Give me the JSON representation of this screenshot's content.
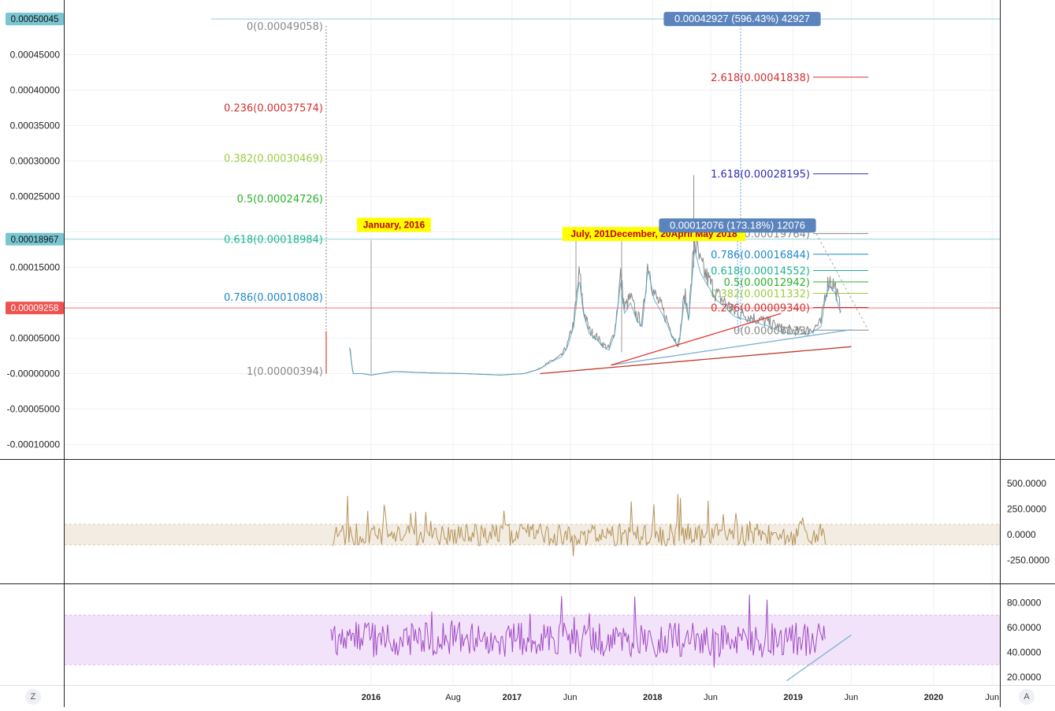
{
  "chart_data": [
    {
      "type": "line",
      "pane": "price",
      "y_ticks": [
        "0.00045000",
        "0.00040000",
        "0.00035000",
        "0.00030000",
        "0.00025000",
        "0.00015000",
        "0.00005000",
        "-0.00000000",
        "-0.00005000",
        "-0.00010000"
      ],
      "y_tick_values": [
        0.00045,
        0.0004,
        0.00035,
        0.0003,
        0.00025,
        0.00015,
        5e-05,
        0,
        -5e-05,
        -0.0001
      ],
      "ylim": [
        -0.000125,
        0.0005
      ],
      "price_labels": [
        {
          "text": "0.00050045",
          "value": 0.00050045,
          "color": "#79c6d2"
        },
        {
          "text": "0.00018967",
          "value": 0.00018967,
          "color": "#79c6d2"
        },
        {
          "text": "0.00009258",
          "value": 9.258e-05,
          "color": "#ef5350"
        }
      ],
      "x_ticks": [
        {
          "label": "2016",
          "date": "2016-01-01",
          "bold": true
        },
        {
          "label": "Aug",
          "date": "2016-08-01",
          "bold": false
        },
        {
          "label": "2017",
          "date": "2017-01-01",
          "bold": true
        },
        {
          "label": "Jun",
          "date": "2017-06-01",
          "bold": false
        },
        {
          "label": "2018",
          "date": "2018-01-01",
          "bold": true
        },
        {
          "label": "Jun",
          "date": "2018-06-01",
          "bold": false
        },
        {
          "label": "2019",
          "date": "2019-01-01",
          "bold": true
        },
        {
          "label": "Jun",
          "date": "2019-06-01",
          "bold": false
        },
        {
          "label": "2020",
          "date": "2020-01-01",
          "bold": true
        },
        {
          "label": "Jun",
          "date": "2020-06-01",
          "bold": false
        }
      ],
      "price_series": [
        [
          "2015-11-06",
          3.9e-05
        ],
        [
          "2015-11-15",
          0.0
        ],
        [
          "2015-12-10",
          0.0
        ],
        [
          "2016-01-01",
          -2e-06
        ],
        [
          "2016-03-01",
          3e-06
        ],
        [
          "2016-06-01",
          1e-06
        ],
        [
          "2016-09-01",
          0.0
        ],
        [
          "2016-12-01",
          -2e-06
        ],
        [
          "2017-02-01",
          0.0
        ],
        [
          "2017-03-10",
          6e-06
        ],
        [
          "2017-04-15",
          1.8e-05
        ],
        [
          "2017-05-10",
          2.5e-05
        ],
        [
          "2017-05-25",
          4e-05
        ],
        [
          "2017-06-10",
          7e-05
        ],
        [
          "2017-06-25",
          0.00014
        ],
        [
          "2017-07-05",
          9e-05
        ],
        [
          "2017-07-20",
          6e-05
        ],
        [
          "2017-08-10",
          5e-05
        ],
        [
          "2017-08-25",
          4e-05
        ],
        [
          "2017-09-10",
          3.5e-05
        ],
        [
          "2017-09-25",
          6e-05
        ],
        [
          "2017-10-10",
          0.000135
        ],
        [
          "2017-10-20",
          9e-05
        ],
        [
          "2017-11-05",
          0.000105
        ],
        [
          "2017-11-20",
          8e-05
        ],
        [
          "2017-12-05",
          7e-05
        ],
        [
          "2017-12-20",
          0.000155
        ],
        [
          "2018-01-05",
          0.00011
        ],
        [
          "2018-01-25",
          9e-05
        ],
        [
          "2018-02-10",
          7e-05
        ],
        [
          "2018-02-25",
          5e-05
        ],
        [
          "2018-03-10",
          4e-05
        ],
        [
          "2018-03-25",
          0.00011
        ],
        [
          "2018-04-05",
          8e-05
        ],
        [
          "2018-04-20",
          0.000185
        ],
        [
          "2018-05-05",
          0.00015
        ],
        [
          "2018-05-25",
          0.00013
        ],
        [
          "2018-06-15",
          0.00011
        ],
        [
          "2018-07-05",
          0.0001
        ],
        [
          "2018-08-01",
          8.5e-05
        ],
        [
          "2018-09-01",
          8e-05
        ],
        [
          "2018-10-01",
          7.5e-05
        ],
        [
          "2018-11-01",
          7e-05
        ],
        [
          "2018-12-01",
          6.2e-05
        ],
        [
          "2019-01-15",
          5.8e-05
        ],
        [
          "2019-02-15",
          6e-05
        ],
        [
          "2019-03-15",
          7e-05
        ],
        [
          "2019-03-25",
          0.00011
        ],
        [
          "2019-04-05",
          0.00013
        ],
        [
          "2019-04-20",
          0.00012
        ],
        [
          "2019-05-01",
          9.5e-05
        ],
        [
          "2019-05-06",
          9.258e-05
        ]
      ],
      "annotations": [
        {
          "text": "January, 2016",
          "date": "2016-01-01",
          "value": 0.00021,
          "color": "#c00000",
          "bg": "#ffff00"
        },
        {
          "text": "July, 201December, 20April May 2018",
          "date": "2018-02-15",
          "value": 0.000197,
          "color": "#c00000",
          "bg": "#ffff00"
        },
        {
          "text": "0.00042927 (596.43%) 42927",
          "date": "2018-09-01",
          "value": 0.00050045,
          "color": "#ffffff",
          "bg": "#5b84bd"
        },
        {
          "text": "0.00012076 (173.18%) 12076",
          "date": "2018-08-15",
          "value": 0.000209,
          "color": "#ffffff",
          "bg": "#5b84bd"
        }
      ],
      "fib_left": [
        {
          "text": "0(0.00049058)",
          "value": 0.00049058,
          "color": "#888888"
        },
        {
          "text": "0.236(0.00037574)",
          "value": 0.00037574,
          "color": "#d32f2f"
        },
        {
          "text": "0.382(0.00030469)",
          "value": 0.00030469,
          "color": "#9ccc41"
        },
        {
          "text": "0.5(0.00024726)",
          "value": 0.00024726,
          "color": "#2bb12b"
        },
        {
          "text": "0.618(0.00018984)",
          "value": 0.00018984,
          "color": "#1fb58f"
        },
        {
          "text": "0.786(0.00010808)",
          "value": 0.00010808,
          "color": "#1e88c8"
        },
        {
          "text": "1(0.00000394)",
          "value": 3.94e-06,
          "color": "#888888"
        }
      ],
      "fib_right": [
        {
          "text": "2.618(0.00041838)",
          "value": 0.00041838,
          "color": "#d32f2f"
        },
        {
          "text": "1.618(0.00028195)",
          "value": 0.00028195,
          "color": "#2b2bb1"
        },
        {
          "text": "1(0.00019764)",
          "value": 0.00019764,
          "color": "#888888"
        },
        {
          "text": "0.786(0.00016844)",
          "value": 0.00016844,
          "color": "#1e88c8"
        },
        {
          "text": "0.618(0.00014552)",
          "value": 0.00014552,
          "color": "#1fb58f"
        },
        {
          "text": "0.5(0.00012942)",
          "value": 0.00012942,
          "color": "#2bb12b"
        },
        {
          "text": "0.382(0.00011332)",
          "value": 0.00011332,
          "color": "#9ccc41"
        },
        {
          "text": "0.236(0.00009340)",
          "value": 9.34e-05,
          "color": "#d32f2f"
        },
        {
          "text": "0(0.00006133)",
          "value": 6.133e-05,
          "color": "#888888"
        }
      ],
      "trendlines": [
        {
          "from": [
            "2017-03-15",
            0.0
          ],
          "to": [
            "2019-06-01",
            3.8e-05
          ],
          "color": "#c0392b"
        },
        {
          "from": [
            "2017-09-15",
            1.2e-05
          ],
          "to": [
            "2019-06-01",
            6.2e-05
          ],
          "color": "#7fb3d5"
        },
        {
          "from": [
            "2017-09-15",
            1.2e-05
          ],
          "to": [
            "2018-12-01",
            8.5e-05
          ],
          "color": "#e53935"
        }
      ]
    },
    {
      "type": "line",
      "pane": "cci",
      "y_ticks": [
        "500.0000",
        "250.0000",
        "0.0000",
        "-250.0000"
      ],
      "y_tick_values": [
        500,
        250,
        0,
        -250
      ],
      "ylim": [
        -420,
        680
      ],
      "band": [
        -100,
        100
      ],
      "color": "#b5955a"
    },
    {
      "type": "line",
      "pane": "rsi",
      "y_ticks": [
        "80.0000",
        "60.0000",
        "40.0000",
        "20.0000"
      ],
      "y_tick_values": [
        80,
        60,
        40,
        20
      ],
      "ylim": [
        13,
        95
      ],
      "band": [
        30,
        70
      ],
      "color": "#a24bc4",
      "trendline": {
        "from": [
          "2018-12-15",
          17
        ],
        "to": [
          "2019-06-01",
          54
        ],
        "color": "#7fb3d5"
      }
    }
  ],
  "controls": {
    "left_button": "Z",
    "right_button": "A"
  }
}
